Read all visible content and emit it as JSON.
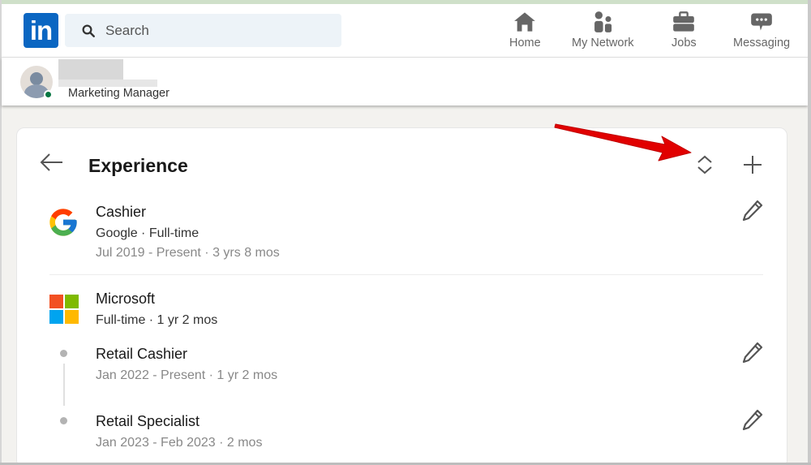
{
  "nav": {
    "logo_text": "in",
    "search_placeholder": "Search",
    "items": [
      {
        "label": "Home",
        "icon": "home-icon"
      },
      {
        "label": "My Network",
        "icon": "network-icon"
      },
      {
        "label": "Jobs",
        "icon": "briefcase-icon"
      },
      {
        "label": "Messaging",
        "icon": "messaging-icon"
      }
    ]
  },
  "profile": {
    "headline": "Marketing Manager",
    "status": "online"
  },
  "experience": {
    "title": "Experience",
    "entries": [
      {
        "logo": "google-logo",
        "role": "Cashier",
        "company_type": "Google · Full-time",
        "dates": "Jul 2019 - Present · 3 yrs 8 mos"
      },
      {
        "logo": "microsoft-logo",
        "company": "Microsoft",
        "summary": "Full-time · 1 yr 2 mos",
        "positions": [
          {
            "role": "Retail Cashier",
            "dates": "Jan 2022 - Present · 1 yr 2 mos"
          },
          {
            "role": "Retail Specialist",
            "dates": "Jan 2023 - Feb 2023 · 2 mos"
          }
        ]
      }
    ]
  },
  "colors": {
    "brand": "#0a66c2",
    "annotation_arrow": "#e10000",
    "online": "#057642"
  }
}
